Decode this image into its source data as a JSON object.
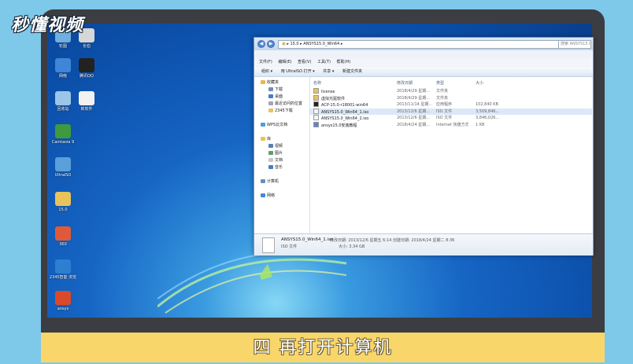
{
  "logo": "秒懂视频",
  "desktop": {
    "icons": [
      {
        "label": "轮图",
        "color": "#6fb0e0"
      },
      {
        "label": "长伯",
        "color": "#d7d7d7"
      },
      {
        "label": "网络",
        "color": "#3f86d8"
      },
      {
        "label": "腾讯QQ",
        "color": "#222222"
      },
      {
        "label": "回收站",
        "color": "#9bc6e8"
      },
      {
        "label": "新软件",
        "color": "#f2f2f2"
      },
      {
        "label": "Camtasia 9",
        "color": "#3e9a3c"
      },
      {
        "label": "UltraISO",
        "color": "#5aa0d8"
      },
      {
        "label": "15.0",
        "color": "#e8c35a"
      },
      {
        "label": "360",
        "color": "#e05a3a"
      },
      {
        "label": "2345智能\n浏览",
        "color": "#2c7fd1"
      },
      {
        "label": "ansys",
        "color": "#d84a2a"
      }
    ]
  },
  "explorer": {
    "address": [
      "15.0",
      "ANSYS15.0_Win64"
    ],
    "search_placeholder": "搜索 ANSYS15.0",
    "menu": [
      "文件(F)",
      "编辑(E)",
      "查看(V)",
      "工具(T)",
      "帮助(H)"
    ],
    "toolbar": [
      "组织 ▾",
      "用 UltraISO 打开 ▾",
      "共享 ▾",
      "新建文件夹"
    ],
    "nav": [
      {
        "label": "收藏夹",
        "color": "#e8b84a"
      },
      {
        "label": "下载",
        "color": "#6c8fc0"
      },
      {
        "label": "桌面",
        "color": "#4a7cc0"
      },
      {
        "label": "最近访问的位置",
        "color": "#9aa8b8"
      },
      {
        "label": "2345下载",
        "color": "#e8c35a"
      },
      {
        "label": "WPS云文档",
        "color": "#4aa0e0"
      },
      {
        "label": "库",
        "color": "#e8c35a"
      },
      {
        "label": "视频",
        "color": "#5a7fb0"
      },
      {
        "label": "图片",
        "color": "#5a9f6a"
      },
      {
        "label": "文档",
        "color": "#c8c8c8"
      },
      {
        "label": "音乐",
        "color": "#4a7cc0"
      },
      {
        "label": "计算机",
        "color": "#6a8fb8"
      },
      {
        "label": "网络",
        "color": "#4a86d8"
      }
    ],
    "columns": [
      "名称",
      "修改日期",
      "类型",
      "大小"
    ],
    "files": [
      {
        "name": "license",
        "date": "2018/4/29 星期...",
        "type": "文件夹",
        "size": "",
        "icon": "#e8c35a"
      },
      {
        "name": "虚拟光驱软件",
        "date": "2018/4/29 星期...",
        "type": "文件夹",
        "size": "",
        "icon": "#e8c35a"
      },
      {
        "name": "ACP-15.0-r18001-win64",
        "date": "2013/11/14 星期...",
        "type": "应用程序",
        "size": "102,840 KB",
        "icon": "#222222"
      },
      {
        "name": "ANSYS15.0_Win64_1.iso",
        "date": "2013/12/6 星期...",
        "type": "ISO 文件",
        "size": "3,509,846...",
        "icon": "#f4f4f4"
      },
      {
        "name": "ANSYS15.0_Win64_2.iso",
        "date": "2013/12/6 星期...",
        "type": "ISO 文件",
        "size": "3,846,026...",
        "icon": "#f4f4f4"
      },
      {
        "name": "ansys15.0安装教程",
        "date": "2018/4/24 星期...",
        "type": "Internet 快捷方式",
        "size": "1 KB",
        "icon": "#5a86c8"
      }
    ],
    "selected_index": 3,
    "details": {
      "filename": "ANSYS15.0_Win64_1.iso",
      "modified": "修改日期: 2013/12/6 星期五 6:14",
      "created": "创建日期: 2018/4/24 星期二 8:36",
      "type": "ISO 文件",
      "size": "大小: 3.34 GB"
    }
  },
  "caption": "四  再打开计算机"
}
